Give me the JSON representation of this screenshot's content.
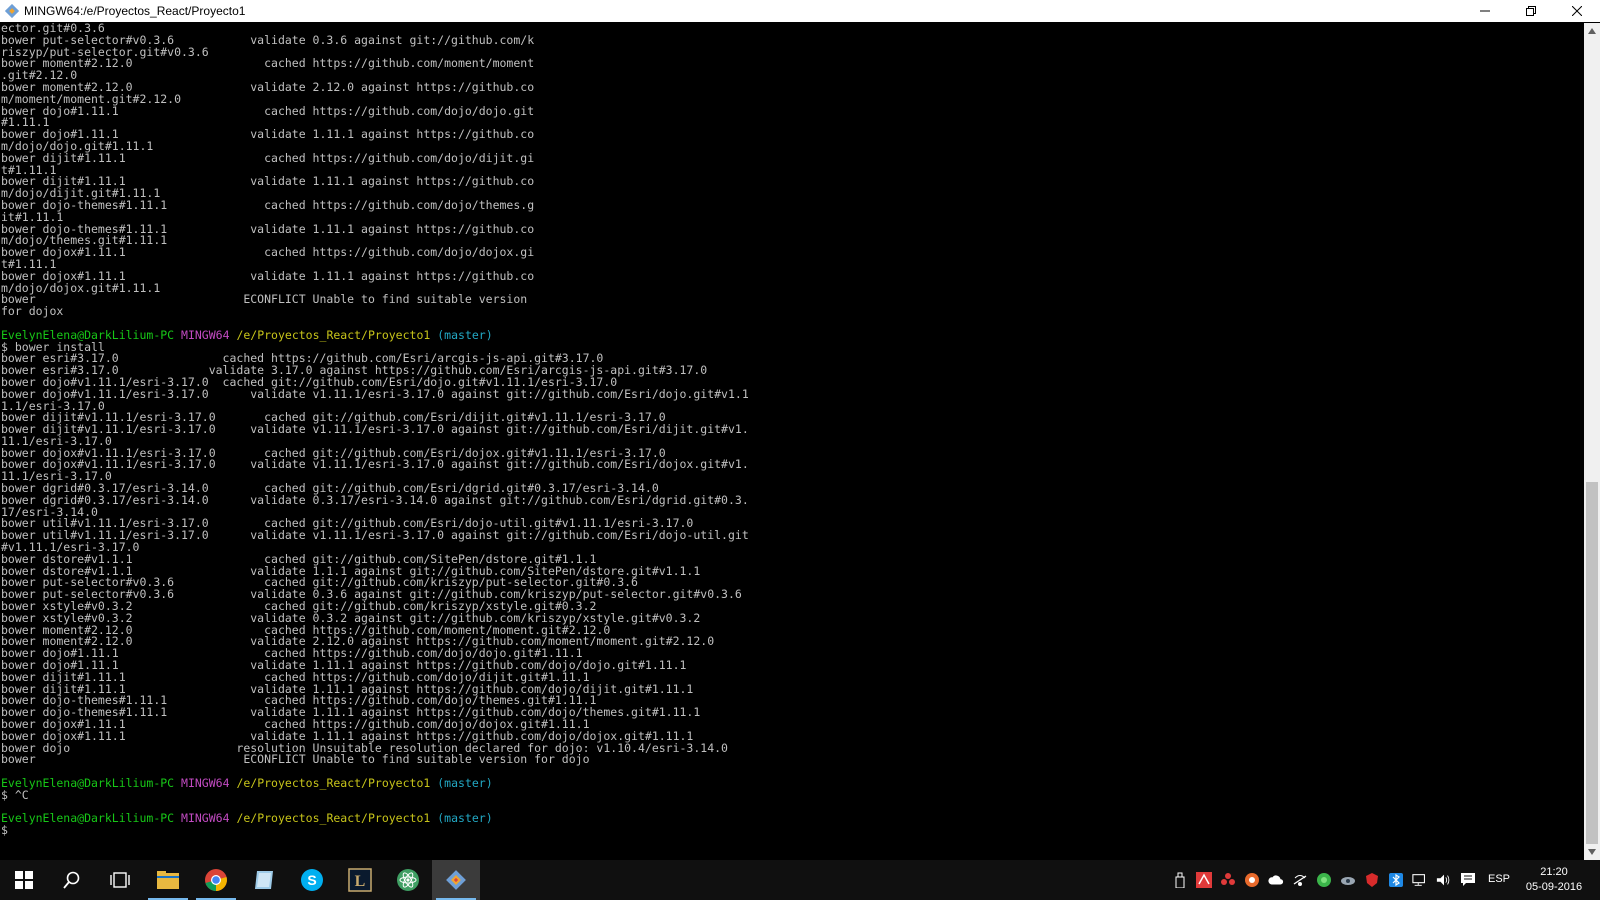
{
  "window": {
    "title": "MINGW64:/e/Proyectos_React/Proyecto1",
    "minimize": "—",
    "maximize": "❐",
    "close": "✕"
  },
  "colors": {
    "terminal_bg": "#000000",
    "terminal_text": "#c0c0c0",
    "prompt_user": "#17c717",
    "prompt_mingw": "#c24bc2",
    "prompt_path": "#c7c41a",
    "prompt_branch": "#22a8c4",
    "taskbar_bg": "#101010"
  },
  "terminal": {
    "lines": [
      {
        "t": "ector.git#0.3.6"
      },
      {
        "t": "bower put-selector#v0.3.6           validate 0.3.6 against git://github.com/k"
      },
      {
        "t": "riszyp/put-selector.git#v0.3.6"
      },
      {
        "t": "bower moment#2.12.0                   cached https://github.com/moment/moment"
      },
      {
        "t": ".git#2.12.0"
      },
      {
        "t": "bower moment#2.12.0                 validate 2.12.0 against https://github.co"
      },
      {
        "t": "m/moment/moment.git#2.12.0"
      },
      {
        "t": "bower dojo#1.11.1                     cached https://github.com/dojo/dojo.git"
      },
      {
        "t": "#1.11.1"
      },
      {
        "t": "bower dojo#1.11.1                   validate 1.11.1 against https://github.co"
      },
      {
        "t": "m/dojo/dojo.git#1.11.1"
      },
      {
        "t": "bower dijit#1.11.1                    cached https://github.com/dojo/dijit.gi"
      },
      {
        "t": "t#1.11.1"
      },
      {
        "t": "bower dijit#1.11.1                  validate 1.11.1 against https://github.co"
      },
      {
        "t": "m/dojo/dijit.git#1.11.1"
      },
      {
        "t": "bower dojo-themes#1.11.1              cached https://github.com/dojo/themes.g"
      },
      {
        "t": "it#1.11.1"
      },
      {
        "t": "bower dojo-themes#1.11.1            validate 1.11.1 against https://github.co"
      },
      {
        "t": "m/dojo/themes.git#1.11.1"
      },
      {
        "t": "bower dojox#1.11.1                    cached https://github.com/dojo/dojox.gi"
      },
      {
        "t": "t#1.11.1"
      },
      {
        "t": "bower dojox#1.11.1                  validate 1.11.1 against https://github.co"
      },
      {
        "t": "m/dojo/dojox.git#1.11.1"
      },
      {
        "t": "bower                              ECONFLICT Unable to find suitable version"
      },
      {
        "t": "for dojox"
      },
      {
        "t": ""
      },
      {
        "prompt": true,
        "user": "EvelynElena@DarkLilium-PC",
        "mingw": "MINGW64",
        "path": "/e/Proyectos_React/Proyecto1",
        "branch": "(master)"
      },
      {
        "t": "$ bower install"
      },
      {
        "t": "bower esri#3.17.0               cached https://github.com/Esri/arcgis-js-api.git#3.17.0"
      },
      {
        "t": "bower esri#3.17.0             validate 3.17.0 against https://github.com/Esri/arcgis-js-api.git#3.17.0"
      },
      {
        "t": "bower dojo#v1.11.1/esri-3.17.0  cached git://github.com/Esri/dojo.git#v1.11.1/esri-3.17.0"
      },
      {
        "t": "bower dojo#v1.11.1/esri-3.17.0      validate v1.11.1/esri-3.17.0 against git://github.com/Esri/dojo.git#v1.1"
      },
      {
        "t": "1.1/esri-3.17.0"
      },
      {
        "t": "bower dijit#v1.11.1/esri-3.17.0       cached git://github.com/Esri/dijit.git#v1.11.1/esri-3.17.0"
      },
      {
        "t": "bower dijit#v1.11.1/esri-3.17.0     validate v1.11.1/esri-3.17.0 against git://github.com/Esri/dijit.git#v1."
      },
      {
        "t": "11.1/esri-3.17.0"
      },
      {
        "t": "bower dojox#v1.11.1/esri-3.17.0       cached git://github.com/Esri/dojox.git#v1.11.1/esri-3.17.0"
      },
      {
        "t": "bower dojox#v1.11.1/esri-3.17.0     validate v1.11.1/esri-3.17.0 against git://github.com/Esri/dojox.git#v1."
      },
      {
        "t": "11.1/esri-3.17.0"
      },
      {
        "t": "bower dgrid#0.3.17/esri-3.14.0        cached git://github.com/Esri/dgrid.git#0.3.17/esri-3.14.0"
      },
      {
        "t": "bower dgrid#0.3.17/esri-3.14.0      validate 0.3.17/esri-3.14.0 against git://github.com/Esri/dgrid.git#0.3."
      },
      {
        "t": "17/esri-3.14.0"
      },
      {
        "t": "bower util#v1.11.1/esri-3.17.0        cached git://github.com/Esri/dojo-util.git#v1.11.1/esri-3.17.0"
      },
      {
        "t": "bower util#v1.11.1/esri-3.17.0      validate v1.11.1/esri-3.17.0 against git://github.com/Esri/dojo-util.git"
      },
      {
        "t": "#v1.11.1/esri-3.17.0"
      },
      {
        "t": "bower dstore#v1.1.1                   cached git://github.com/SitePen/dstore.git#1.1.1"
      },
      {
        "t": "bower dstore#v1.1.1                 validate 1.1.1 against git://github.com/SitePen/dstore.git#v1.1.1"
      },
      {
        "t": "bower put-selector#v0.3.6             cached git://github.com/kriszyp/put-selector.git#0.3.6"
      },
      {
        "t": "bower put-selector#v0.3.6           validate 0.3.6 against git://github.com/kriszyp/put-selector.git#v0.3.6"
      },
      {
        "t": "bower xstyle#v0.3.2                   cached git://github.com/kriszyp/xstyle.git#0.3.2"
      },
      {
        "t": "bower xstyle#v0.3.2                 validate 0.3.2 against git://github.com/kriszyp/xstyle.git#v0.3.2"
      },
      {
        "t": "bower moment#2.12.0                   cached https://github.com/moment/moment.git#2.12.0"
      },
      {
        "t": "bower moment#2.12.0                 validate 2.12.0 against https://github.com/moment/moment.git#2.12.0"
      },
      {
        "t": "bower dojo#1.11.1                     cached https://github.com/dojo/dojo.git#1.11.1"
      },
      {
        "t": "bower dojo#1.11.1                   validate 1.11.1 against https://github.com/dojo/dojo.git#1.11.1"
      },
      {
        "t": "bower dijit#1.11.1                    cached https://github.com/dojo/dijit.git#1.11.1"
      },
      {
        "t": "bower dijit#1.11.1                  validate 1.11.1 against https://github.com/dojo/dijit.git#1.11.1"
      },
      {
        "t": "bower dojo-themes#1.11.1              cached https://github.com/dojo/themes.git#1.11.1"
      },
      {
        "t": "bower dojo-themes#1.11.1            validate 1.11.1 against https://github.com/dojo/themes.git#1.11.1"
      },
      {
        "t": "bower dojox#1.11.1                    cached https://github.com/dojo/dojox.git#1.11.1"
      },
      {
        "t": "bower dojox#1.11.1                  validate 1.11.1 against https://github.com/dojo/dojox.git#1.11.1"
      },
      {
        "t": "bower dojo                        resolution Unsuitable resolution declared for dojo: v1.10.4/esri-3.14.0"
      },
      {
        "t": "bower                              ECONFLICT Unable to find suitable version for dojo"
      },
      {
        "t": ""
      },
      {
        "prompt": true,
        "user": "EvelynElena@DarkLilium-PC",
        "mingw": "MINGW64",
        "path": "/e/Proyectos_React/Proyecto1",
        "branch": "(master)"
      },
      {
        "t": "$ ^C"
      },
      {
        "t": ""
      },
      {
        "prompt": true,
        "user": "EvelynElena@DarkLilium-PC",
        "mingw": "MINGW64",
        "path": "/e/Proyectos_React/Proyecto1",
        "branch": "(master)"
      },
      {
        "t": "$"
      }
    ]
  },
  "scrollbar": {
    "position": 0.45,
    "visible_fraction": 0.45
  },
  "taskbar": {
    "apps": [
      {
        "name": "start-button",
        "icon": "windows-logo-icon",
        "open": false,
        "active": false
      },
      {
        "name": "search-button",
        "icon": "search-icon",
        "open": false,
        "active": false
      },
      {
        "name": "task-view-button",
        "icon": "task-view-icon",
        "open": false,
        "active": false
      },
      {
        "name": "file-explorer",
        "icon": "folder-icon",
        "open": true,
        "active": false
      },
      {
        "name": "chrome",
        "icon": "chrome-icon",
        "open": true,
        "active": false
      },
      {
        "name": "notepad",
        "icon": "notepad-icon",
        "open": false,
        "active": false
      },
      {
        "name": "skype",
        "icon": "skype-icon",
        "open": false,
        "active": false
      },
      {
        "name": "league-of-legends",
        "icon": "lol-icon",
        "open": false,
        "active": false
      },
      {
        "name": "atom-editor",
        "icon": "atom-icon",
        "open": false,
        "active": false
      },
      {
        "name": "git-bash",
        "icon": "git-icon",
        "open": true,
        "active": true
      }
    ],
    "tray": {
      "language": "ESP",
      "time": "21:20",
      "date": "05-09-2016"
    }
  }
}
